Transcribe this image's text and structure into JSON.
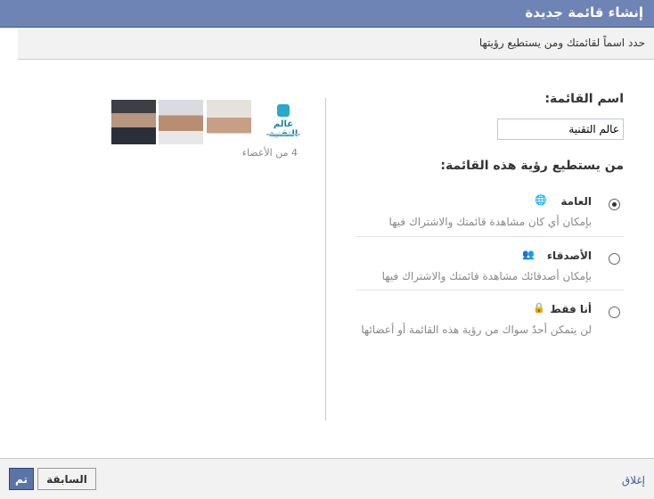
{
  "dialog": {
    "title": "إنشاء قائمة جديدة"
  },
  "subheader": {
    "text": "حدد اسماً لقائمتك ومن يستطيع رؤيتها"
  },
  "form": {
    "name_label": "اسم القائمة:",
    "name_value": "عالم التقنية",
    "visibility_label": "من يستطيع رؤية هذه القائمة:",
    "options": [
      {
        "label": "العامة",
        "icon": "globe-icon",
        "description": "بإمكان أي كان مشاهدة قائمتك والاشتراك فيها",
        "selected": true
      },
      {
        "label": "الأصدقاء",
        "icon": "friends-icon",
        "description": "بإمكان أصدقائك مشاهدة قائمتك والاشتراك فيها",
        "selected": false
      },
      {
        "label": "أنا فقط",
        "icon": "lock-icon",
        "description": "لن يتمكن أحدٌ سواك من رؤية هذه القائمة أو أعضائها",
        "selected": false
      }
    ]
  },
  "members": {
    "logo_text": "عالم التقنية",
    "count_text": "4 من الأعضاء"
  },
  "footer": {
    "done_label": "تم",
    "back_label": "السابقة",
    "close_label": "إغلاق"
  },
  "colors": {
    "title_bar": "#6d84b4",
    "link": "#3b5998",
    "primary_button": "#5b74a8"
  }
}
